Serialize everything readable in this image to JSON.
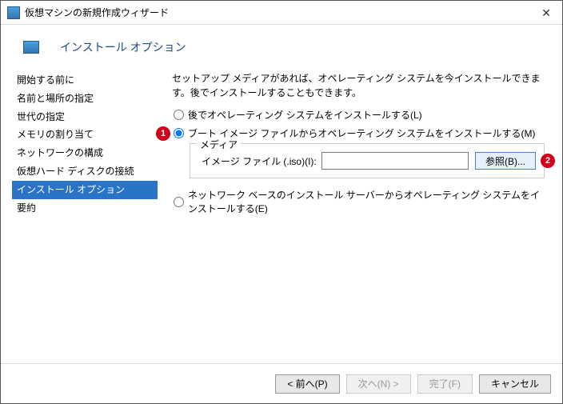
{
  "window": {
    "title": "仮想マシンの新規作成ウィザード"
  },
  "header": {
    "title": "インストール オプション"
  },
  "sidebar": {
    "items": [
      {
        "label": "開始する前に"
      },
      {
        "label": "名前と場所の指定"
      },
      {
        "label": "世代の指定"
      },
      {
        "label": "メモリの割り当て"
      },
      {
        "label": "ネットワークの構成"
      },
      {
        "label": "仮想ハード ディスクの接続"
      },
      {
        "label": "インストール オプション"
      },
      {
        "label": "要約"
      }
    ]
  },
  "content": {
    "description": "セットアップ メディアがあれば、オペレーティング システムを今インストールできます。後でインストールすることもできます。",
    "radio_later": "後でオペレーティング システムをインストールする(L)",
    "radio_boot_image": "ブート イメージ ファイルからオペレーティング システムをインストールする(M)",
    "fieldset_legend": "メディア",
    "image_file_label": "イメージ ファイル (.iso)(I):",
    "image_file_value": "",
    "browse_label": "参照(B)...",
    "radio_network": "ネットワーク ベースのインストール サーバーからオペレーティング システムをインストールする(E)"
  },
  "callouts": {
    "c1": "1",
    "c2": "2"
  },
  "footer": {
    "prev": "< 前へ(P)",
    "next": "次へ(N) >",
    "finish": "完了(F)",
    "cancel": "キャンセル"
  }
}
